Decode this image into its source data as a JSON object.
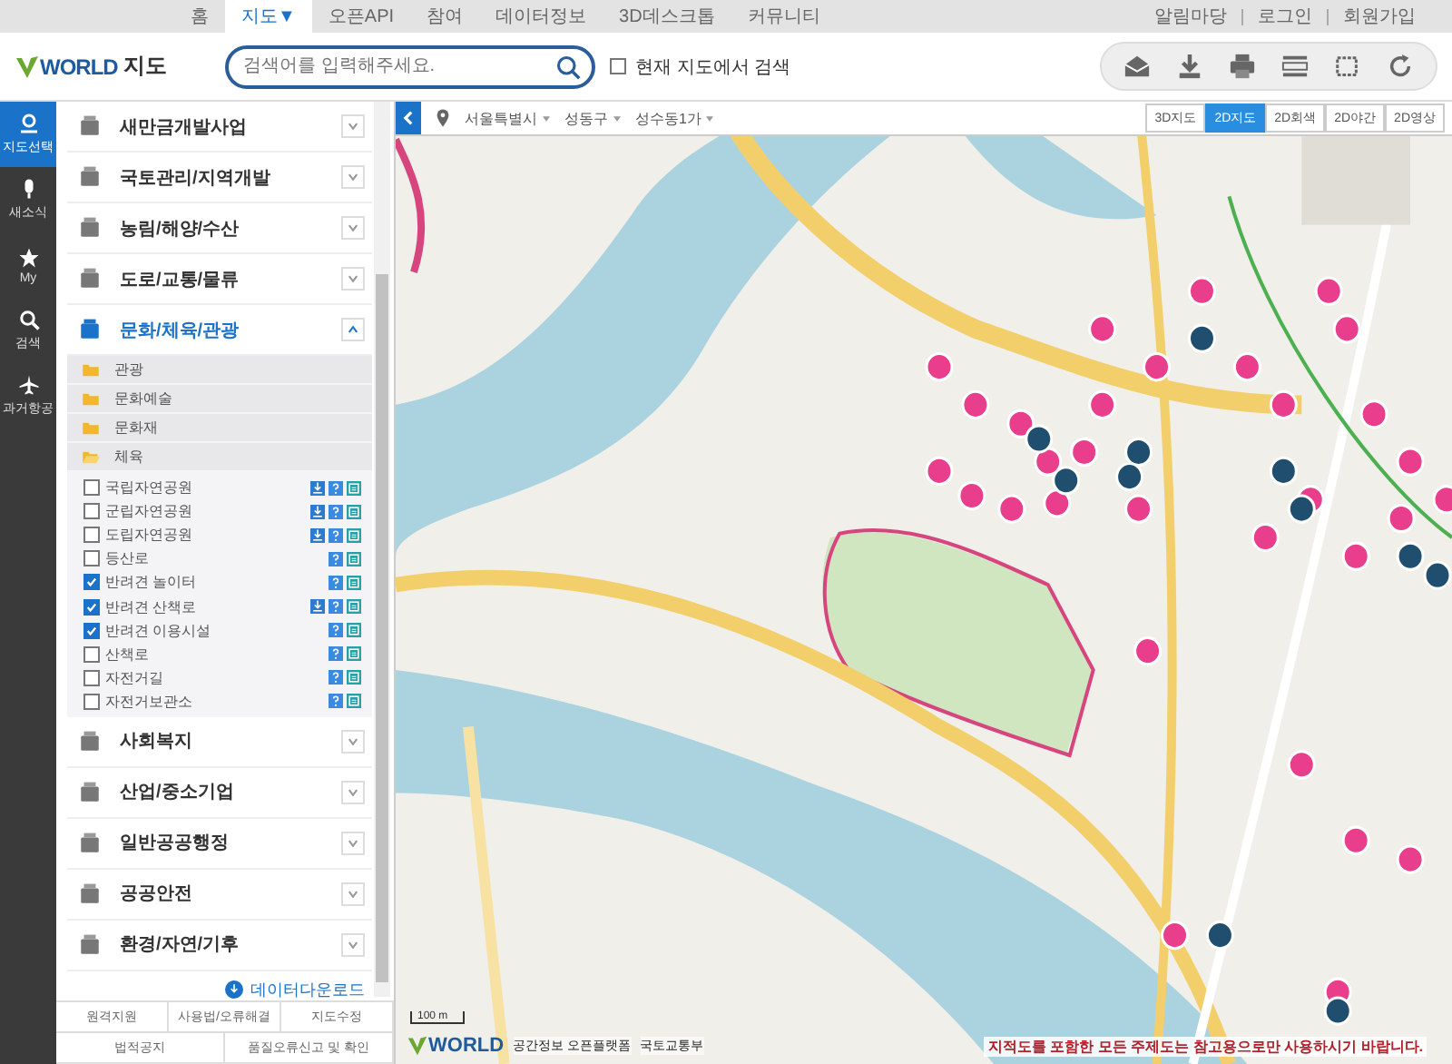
{
  "top_nav": {
    "items": [
      {
        "label": "홈",
        "selected": false
      },
      {
        "label": "지도▼",
        "selected": true
      },
      {
        "label": "오픈API",
        "selected": false
      },
      {
        "label": "참여",
        "selected": false
      },
      {
        "label": "데이터정보",
        "selected": false
      },
      {
        "label": "3D데스크톱",
        "selected": false
      },
      {
        "label": "커뮤니티",
        "selected": false
      }
    ],
    "account_links": [
      "알림마당",
      "로그인",
      "회원가입"
    ]
  },
  "header": {
    "logo_brand": "WORLD",
    "logo_title": "지도",
    "search": {
      "placeholder": "검색어를 입력해주세요."
    },
    "map_search_option": {
      "label": "현재 지도에서 검색",
      "checked": false
    }
  },
  "rail": [
    {
      "label": "지도선택",
      "selected": true
    },
    {
      "label": "새소식",
      "selected": false
    },
    {
      "label": "My",
      "selected": false
    },
    {
      "label": "검색",
      "selected": false
    },
    {
      "label": "과거항공",
      "selected": false
    }
  ],
  "categories": [
    {
      "label": "새만금개발사업",
      "expanded": false
    },
    {
      "label": "국토관리/지역개발",
      "expanded": false
    },
    {
      "label": "농림/해양/수산",
      "expanded": false
    },
    {
      "label": "도로/교통/물류",
      "expanded": false
    },
    {
      "label": "문화/체육/관광",
      "expanded": true,
      "children": [
        {
          "label": "관광",
          "expanded": false
        },
        {
          "label": "문화예술",
          "expanded": false
        },
        {
          "label": "문화재",
          "expanded": false
        },
        {
          "label": "체육",
          "expanded": true,
          "children": [
            {
              "label": "국립자연공원",
              "checked": false,
              "download": true
            },
            {
              "label": "군립자연공원",
              "checked": false,
              "download": true
            },
            {
              "label": "도립자연공원",
              "checked": false,
              "download": true
            },
            {
              "label": "등산로",
              "checked": false,
              "download": false
            },
            {
              "label": "반려견 놀이터",
              "checked": true,
              "download": false
            },
            {
              "label": "반려견 산책로",
              "checked": true,
              "download": true
            },
            {
              "label": "반려견 이용시설",
              "checked": true,
              "download": false
            },
            {
              "label": "산책로",
              "checked": false,
              "download": false
            },
            {
              "label": "자전거길",
              "checked": false,
              "download": false
            },
            {
              "label": "자전거보관소",
              "checked": false,
              "download": false
            }
          ]
        }
      ]
    },
    {
      "label": "사회복지",
      "expanded": false
    },
    {
      "label": "산업/중소기업",
      "expanded": false
    },
    {
      "label": "일반공공행정",
      "expanded": false
    },
    {
      "label": "공공안전",
      "expanded": false
    },
    {
      "label": "환경/자연/기후",
      "expanded": false
    }
  ],
  "data_download": "데이터다운로드",
  "footer_links": [
    [
      "원격지원",
      "사용법/오류해결",
      "지도수정"
    ],
    [
      "법적공지",
      "품질오류신고 및 확인"
    ]
  ],
  "map": {
    "breadcrumb": [
      "서울특별시",
      "성동구",
      "성수동1가"
    ],
    "view_tabs": [
      {
        "label": "3D지도",
        "selected": false
      },
      {
        "label": "2D지도",
        "selected": true
      },
      {
        "label": "2D회색",
        "selected": false
      },
      {
        "label": "2D야간",
        "selected": false
      },
      {
        "label": "2D영상",
        "selected": false
      }
    ],
    "scale": "100 m",
    "footer_brand": "WORLD",
    "footer_org": "공간정보 오픈플랫폼",
    "footer_ministry": "국토교통부",
    "notice": "지적도를 포함한 모든 주제도는 참고용으로만 사용하시기 바랍니다."
  }
}
